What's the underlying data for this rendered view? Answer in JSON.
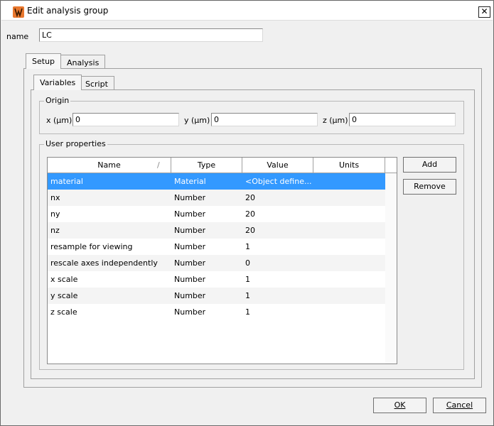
{
  "window": {
    "title": "Edit analysis group",
    "close_glyph": "✕"
  },
  "name_field": {
    "label": "name",
    "value": "LC"
  },
  "main_tabs": [
    {
      "label": "Setup"
    },
    {
      "label": "Analysis"
    }
  ],
  "sub_tabs": [
    {
      "label": "Variables"
    },
    {
      "label": "Script"
    }
  ],
  "origin": {
    "title": "Origin",
    "x_label": "x (µm)",
    "x_value": "0",
    "y_label": "y (µm)",
    "y_value": "0",
    "z_label": "z (µm)",
    "z_value": "0"
  },
  "user_properties": {
    "title": "User properties",
    "columns": [
      "Name",
      "Type",
      "Value",
      "Units"
    ],
    "sort_glyph": "/",
    "rows": [
      {
        "name": "material",
        "type": "Material",
        "value": "<Object define...",
        "units": ""
      },
      {
        "name": "nx",
        "type": "Number",
        "value": "20",
        "units": ""
      },
      {
        "name": "ny",
        "type": "Number",
        "value": "20",
        "units": ""
      },
      {
        "name": "nz",
        "type": "Number",
        "value": "20",
        "units": ""
      },
      {
        "name": "resample for viewing",
        "type": "Number",
        "value": "1",
        "units": ""
      },
      {
        "name": "rescale axes independently",
        "type": "Number",
        "value": "0",
        "units": ""
      },
      {
        "name": "x scale",
        "type": "Number",
        "value": "1",
        "units": ""
      },
      {
        "name": "y scale",
        "type": "Number",
        "value": "1",
        "units": ""
      },
      {
        "name": "z scale",
        "type": "Number",
        "value": "1",
        "units": ""
      }
    ],
    "selected_row": 0,
    "add_label": "Add",
    "remove_label": "Remove"
  },
  "footer": {
    "ok_label": "OK",
    "cancel_label": "Cancel"
  },
  "colors": {
    "selection": "#3399ff",
    "app_icon": "#e8772e"
  }
}
